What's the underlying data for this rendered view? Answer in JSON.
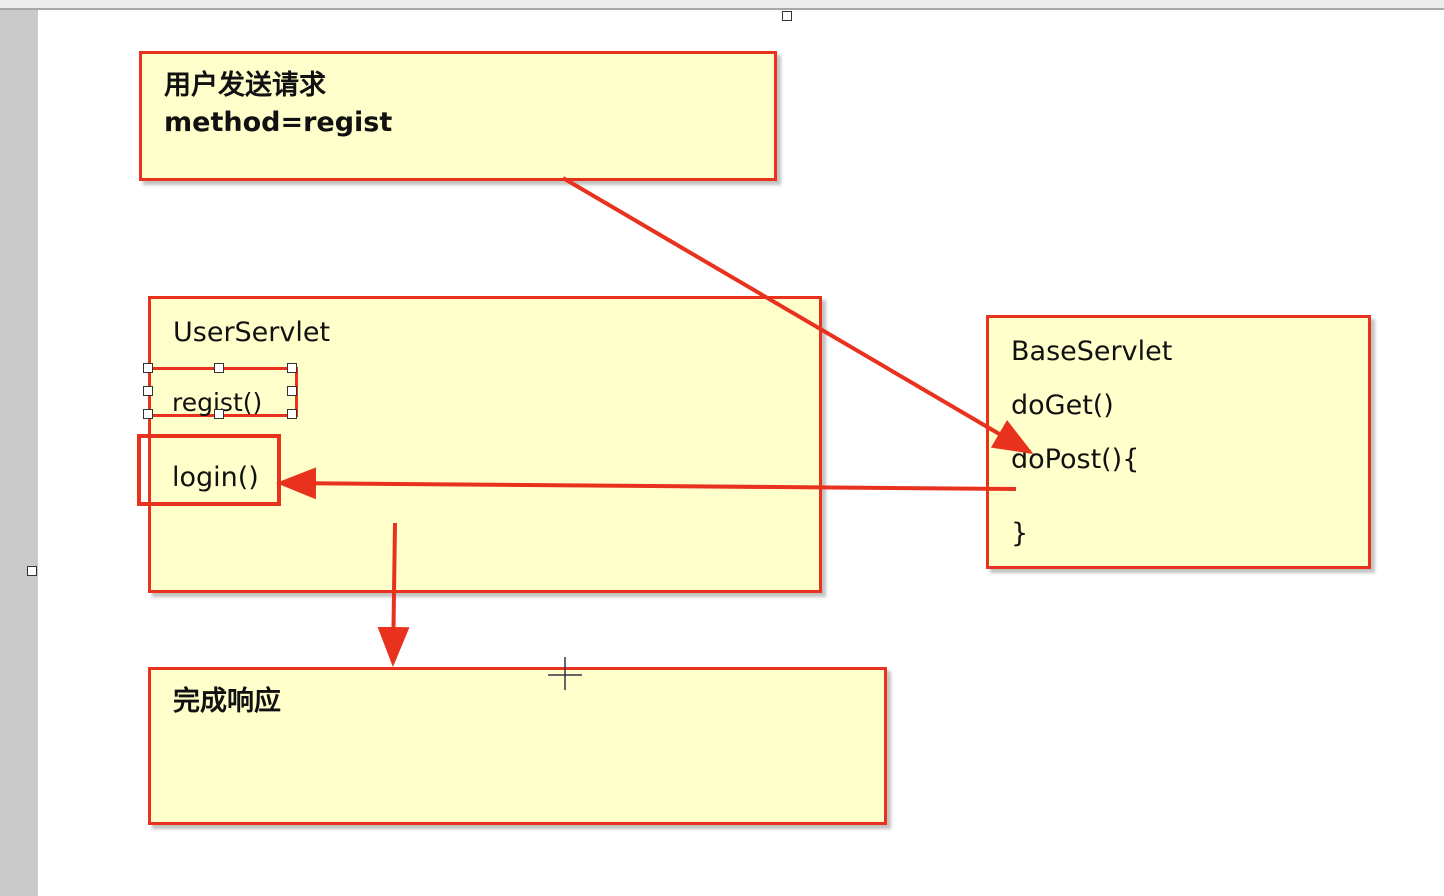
{
  "diagram": {
    "request_box": {
      "line1": "用户发送请求",
      "line2": "method=regist"
    },
    "user_servlet_box": {
      "title": "UserServlet",
      "method_regist": "regist()",
      "method_login": "login()"
    },
    "base_servlet_box": {
      "title": "BaseServlet",
      "line_doget": "doGet()",
      "line_dopost": "doPost(){",
      "line_close": "}"
    },
    "response_box": {
      "label": "完成响应"
    }
  },
  "colors": {
    "box_fill": "#ffffcc",
    "box_border": "#e8321e",
    "arrow": "#e8321e"
  }
}
